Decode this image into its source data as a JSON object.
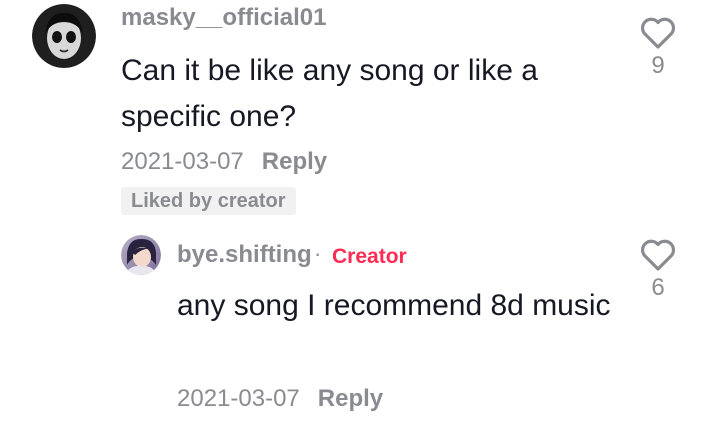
{
  "comment": {
    "username": "masky__official01",
    "text": "Can it be like any song or like a specific one?",
    "date": "2021-03-07",
    "reply_label": "Reply",
    "liked_badge": "Liked by creator",
    "like_count": "9",
    "avatar_icon": "masked-face-avatar"
  },
  "reply": {
    "username": "bye.shifting",
    "separator": "·",
    "creator_label": "Creator",
    "text": "any song I recommend 8d music",
    "date": "2021-03-07",
    "reply_label": "Reply",
    "like_count": "6",
    "avatar_icon": "user-photo-avatar"
  },
  "icons": {
    "like": "heart-outline-icon"
  },
  "colors": {
    "username": "#8a8b91",
    "text": "#161823",
    "creator": "#fe2c55",
    "badge_bg": "#f1f1f2"
  }
}
